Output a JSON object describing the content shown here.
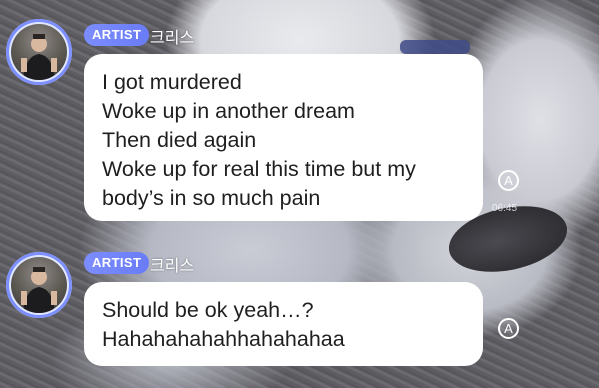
{
  "messages": [
    {
      "badge": "ARTIST",
      "sender": "크리스",
      "lines": [
        "I got murdered",
        "Woke up in another dream",
        "Then died again",
        "Woke up for real this time but my",
        "body’s in so much pain"
      ],
      "translate_glyph": "A",
      "time": "06:45"
    },
    {
      "badge": "ARTIST",
      "sender": "크리스",
      "lines": [
        "Should be ok yeah…?",
        "Hahahahahahhahahahaa"
      ],
      "translate_glyph": "A"
    }
  ],
  "colors": {
    "badge": "#7c8dff",
    "bubble": "#ffffff",
    "text": "#1f1f1f"
  }
}
